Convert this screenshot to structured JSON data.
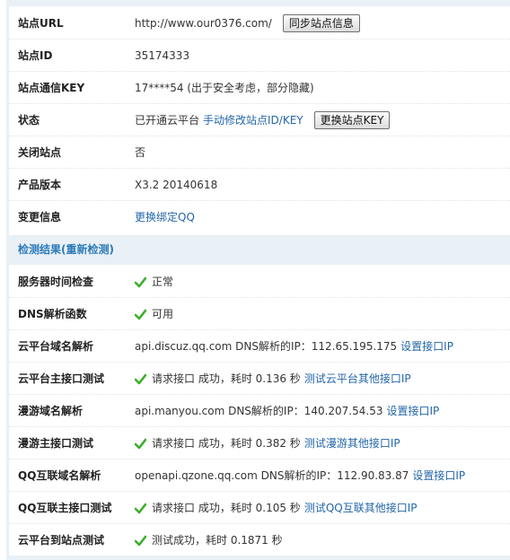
{
  "rows": {
    "site_url": {
      "label": "站点URL",
      "value": "http://www.our0376.com/",
      "button": "同步站点信息"
    },
    "site_id": {
      "label": "站点ID",
      "value": "35174333"
    },
    "site_key": {
      "label": "站点通信KEY",
      "value": "17****54 (出于安全考虑，部分隐藏)"
    },
    "status": {
      "label": "状态",
      "value": "已开通云平台",
      "link": "手动修改站点ID/KEY",
      "button": "更换站点KEY"
    },
    "close_site": {
      "label": "关闭站点",
      "value": "否"
    },
    "version": {
      "label": "产品版本",
      "value": "X3.2 20140618"
    },
    "change_info": {
      "label": "变更信息",
      "link": "更换绑定QQ"
    }
  },
  "section": {
    "title": "检测结果(重新检测)"
  },
  "checks": {
    "server_time": {
      "label": "服务器时间检查",
      "status": "正常",
      "icon": "check-icon"
    },
    "dns_func": {
      "label": "DNS解析函数",
      "status": "可用",
      "icon": "check-icon"
    },
    "cloud_dns": {
      "label": "云平台域名解析",
      "text": "api.discuz.qq.com DNS解析的IP：112.65.195.175",
      "link": "设置接口IP"
    },
    "cloud_main": {
      "label": "云平台主接口测试",
      "text": "请求接口 成功，耗时 0.136 秒",
      "link": "测试云平台其他接口IP",
      "icon": "check-icon"
    },
    "manyou_dns": {
      "label": "漫游域名解析",
      "text": "api.manyou.com DNS解析的IP：140.207.54.53",
      "link": "设置接口IP"
    },
    "manyou_main": {
      "label": "漫游主接口测试",
      "text": "请求接口 成功，耗时 0.382 秒",
      "link": "测试漫游其他接口IP",
      "icon": "check-icon"
    },
    "qq_dns": {
      "label": "QQ互联域名解析",
      "text": "openapi.qzone.qq.com DNS解析的IP：112.90.83.87",
      "link": "设置接口IP"
    },
    "qq_main": {
      "label": "QQ互联主接口测试",
      "text": "请求接口 成功，耗时 0.105 秒",
      "link": "测试QQ互联其他接口IP",
      "icon": "check-icon"
    },
    "cloud_to_site": {
      "label": "云平台到站点测试",
      "text": "测试成功，耗时 0.1871 秒",
      "icon": "check-icon"
    }
  },
  "colors": {
    "accent": "#2d7bb9",
    "link": "#2366a8",
    "check": "#3cae2c",
    "section_bg": "#e9f0f6"
  }
}
